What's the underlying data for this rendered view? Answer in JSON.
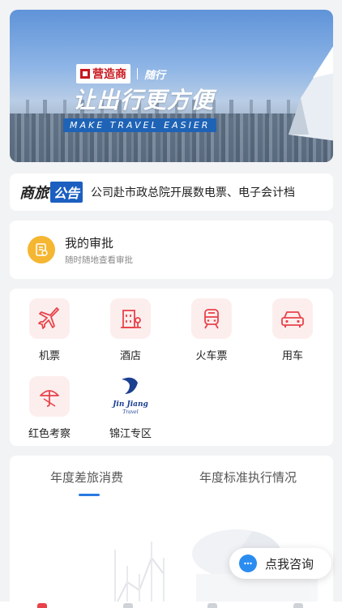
{
  "banner": {
    "brand_name": "营造商",
    "brand_partner": "随行",
    "slogan": "让出行更方便",
    "slogan_en": "MAKE TRAVEL EASIER"
  },
  "notice": {
    "tag_part1": "商旅",
    "tag_part2": "公告",
    "text": "公司赴市政总院开展数电票、电子会计档"
  },
  "approval": {
    "title": "我的审批",
    "subtitle": "随时随地查看审批"
  },
  "services": {
    "items": [
      {
        "label": "机票",
        "icon": "airplane-icon"
      },
      {
        "label": "酒店",
        "icon": "hotel-icon"
      },
      {
        "label": "火车票",
        "icon": "train-icon"
      },
      {
        "label": "用车",
        "icon": "car-icon"
      },
      {
        "label": "红色考察",
        "icon": "umbrella-icon"
      },
      {
        "label": "锦江专区",
        "icon": "jinjiang-logo"
      }
    ],
    "jinjiang_logo_text": "Jin Jiang",
    "jinjiang_logo_sub": "Travel"
  },
  "stats": {
    "tabs": [
      "年度差旅消费",
      "年度标准执行情况"
    ]
  },
  "consult": {
    "label": "点我咨询"
  },
  "colors": {
    "accent_red": "#e8434a",
    "accent_blue": "#2a7ae2",
    "approval_yellow": "#f5b632"
  }
}
